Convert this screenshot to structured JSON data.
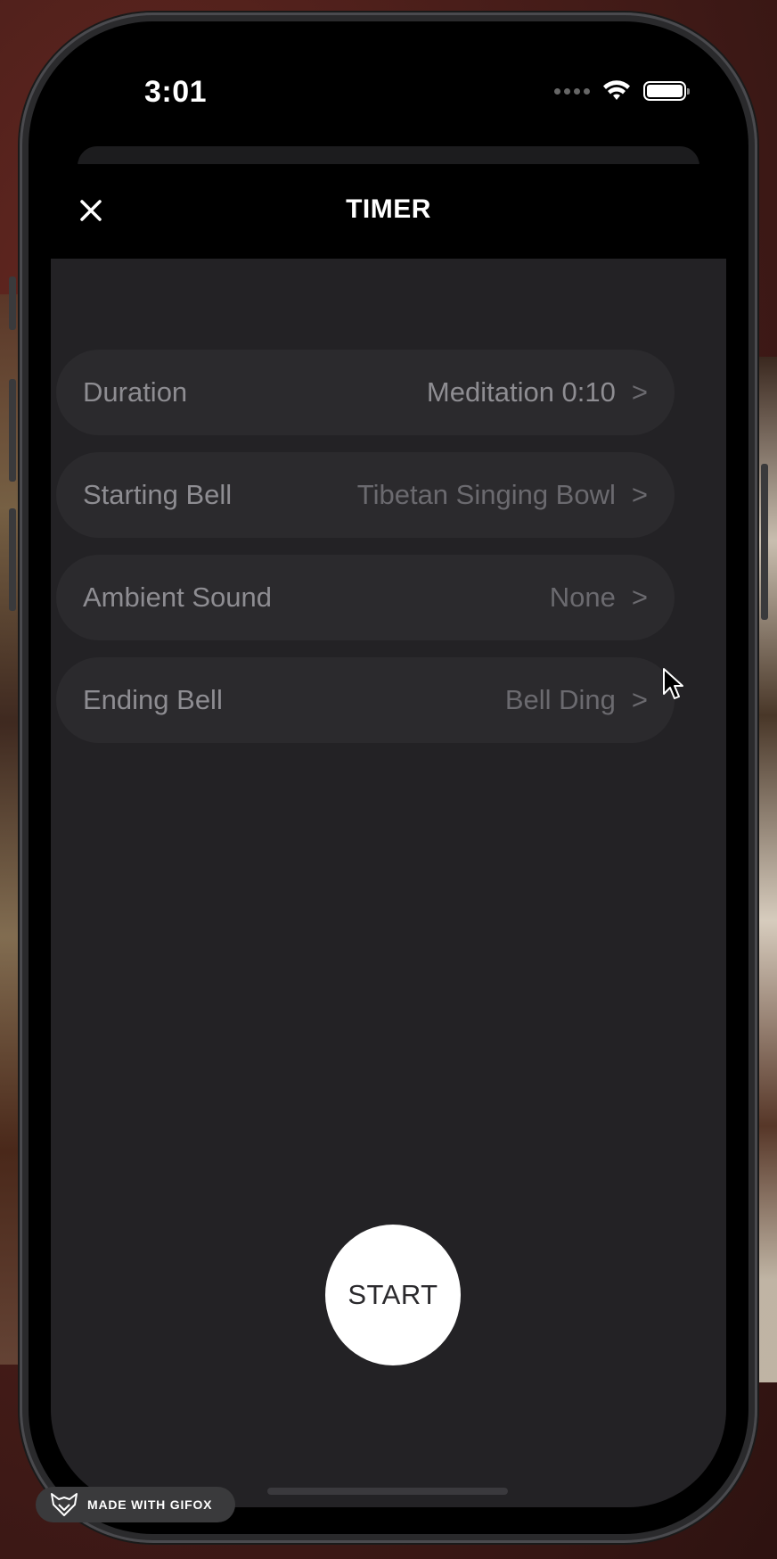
{
  "status_bar": {
    "time": "3:01",
    "icons": [
      "cellular-signal-icon",
      "wifi-icon",
      "battery-icon"
    ]
  },
  "nav": {
    "title": "TIMER",
    "close_icon": "close-icon"
  },
  "settings": {
    "rows": [
      {
        "label": "Duration",
        "value": "Meditation 0:10",
        "chevron": ">"
      },
      {
        "label": "Starting Bell",
        "value": "Tibetan Singing Bowl",
        "chevron": ">"
      },
      {
        "label": "Ambient Sound",
        "value": "None",
        "chevron": ">"
      },
      {
        "label": "Ending Bell",
        "value": "Bell Ding",
        "chevron": ">"
      }
    ]
  },
  "start_button": {
    "label": "START"
  },
  "watermark": {
    "label": "MADE WITH GIFOX",
    "icon": "fox-logo-icon"
  },
  "colors": {
    "background": "#000000",
    "content_bg": "#232225",
    "row_bg": "#2b2a2d",
    "label_text": "#8e8d92",
    "value_text": "#6b6a6f",
    "start_bg": "#ffffff"
  }
}
